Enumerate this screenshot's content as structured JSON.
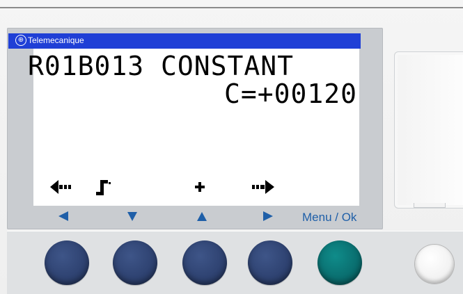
{
  "device": {
    "brand": "Telemecanique",
    "brand_logo_glyph": "⊕"
  },
  "lcd": {
    "line1": "R01B013 CONSTANT",
    "line2": "C=+00120",
    "softkeys": [
      {
        "icon": "left-arrow-icon"
      },
      {
        "icon": "pulse-step-icon"
      },
      {
        "icon": "plus-icon",
        "text": "+"
      },
      {
        "icon": "right-arrow-icon"
      }
    ]
  },
  "navigation": {
    "left_arrow": "◄",
    "down_arrow": "▼",
    "up_arrow": "▲",
    "right_arrow": "►",
    "menu_label": "Menu / Ok"
  },
  "colors": {
    "brand_bar": "#1f3fd6",
    "nav_arrow": "#1f5fa8",
    "button_blue": "#2f4372",
    "button_teal": "#0a6f70"
  }
}
